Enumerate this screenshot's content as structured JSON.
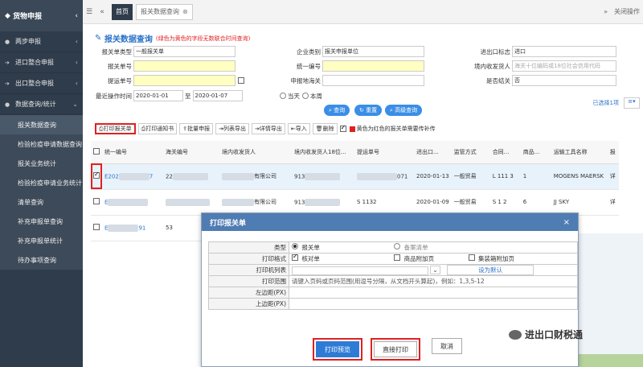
{
  "sidebar": {
    "title": "货物申报",
    "items": [
      {
        "label": "两步申报"
      },
      {
        "label": "进口整合申报"
      },
      {
        "label": "出口整合申报"
      },
      {
        "label": "数据查询/统计"
      }
    ],
    "subitems": [
      {
        "label": "报关数据查询"
      },
      {
        "label": "检验检疫申请数据查询"
      },
      {
        "label": "报关业务统计"
      },
      {
        "label": "检验检疫申请业务统计"
      },
      {
        "label": "清单查询"
      },
      {
        "label": "补充申报单查询"
      },
      {
        "label": "补充申报单统计"
      },
      {
        "label": "待办事项查询"
      }
    ]
  },
  "topbar": {
    "home_tab": "首页",
    "page_tab": "报关数据查询",
    "close_ops": "关闭操作"
  },
  "form": {
    "title": "报关数据查询",
    "note": "(绿色为黄色的字段无数联合时间查询)",
    "fields": {
      "decl_type_label": "报关单类型",
      "decl_type_value": "一般报关单",
      "company_type_label": "企业类别",
      "company_type_value": "报关申报单位",
      "ie_flag_label": "进出口标志",
      "ie_flag_value": "进口",
      "decl_no_label": "报关单号",
      "uni_no_label": "统一编号",
      "consignee_label": "境内收发货人",
      "consignee_placeholder": "海关十位编码或18位社会信用代码",
      "bill_no_label": "提运单号",
      "customs_label": "申报地海关",
      "is_closed_label": "是否结关",
      "is_closed_value": "否",
      "op_time_label": "最近操作时间",
      "date_from": "2020-01-01",
      "date_to_label": "至",
      "date_to": "2020-01-07",
      "today_label": "当天",
      "week_label": "本周"
    },
    "buttons": {
      "query": "查询",
      "reset": "重置",
      "advanced": "高级查询"
    }
  },
  "toolbar": {
    "print": "打印报关单",
    "print_notice": "打印通知书",
    "batch_declare": "批量申报",
    "export_list": "列表导出",
    "export_detail": "详情导出",
    "import": "导入",
    "delete": "删除",
    "red_note": "黄色为红色的报关单需要传补传",
    "selected": "已选择1项"
  },
  "grid": {
    "headers": [
      "统一编号",
      "海关编号",
      "境内收发货人",
      "境内收发货人18位...",
      "提运单号",
      "进出口...",
      "监管方式",
      "合同...",
      "商品...",
      "运输工具名称",
      "报"
    ],
    "rows": [
      {
        "uni": "E202",
        "uni_tail": "7",
        "cust": "22",
        "consignee": "有限公司",
        "c18": "913",
        "bill": "071",
        "date": "2020-01-13",
        "mode": "一般贸易",
        "contract": "L 111 3",
        "items": "1",
        "vessel": "MOGENS MAERSK",
        "op": "详"
      },
      {
        "uni": "E",
        "uni_tail": "",
        "cust": "",
        "consignee": "有限公司",
        "c18": "913",
        "bill": "S 1132",
        "date": "2020-01-09",
        "mode": "一般贸易",
        "contract": "S 1 2",
        "items": "6",
        "vessel": "JJ SKY",
        "op": "详"
      },
      {
        "uni": "E",
        "uni_tail": "91",
        "cust": "53",
        "consignee": "",
        "c18": "",
        "bill": "",
        "date": "",
        "mode": "",
        "contract": "",
        "items": "",
        "vessel": "",
        "op": ""
      }
    ]
  },
  "modal": {
    "title": "打印报关单",
    "close": "×",
    "type_label": "类型",
    "type_opt1": "报关单",
    "type_opt2": "备案清单",
    "format_label": "打印格式",
    "format_opt1": "核对单",
    "format_opt2": "商品附加页",
    "format_opt3": "集装箱附加页",
    "printer_label": "打印机列表",
    "set_default": "设为默认",
    "range_label": "打印范围",
    "range_hint": "请键入页码或页码范围(用逗号分隔，从文档开头算起)，例如：1,3,5-12",
    "left_margin_label": "左边距(PX)",
    "top_margin_label": "上边距(PX)",
    "preview_button": "打印预览",
    "direct_print_button": "直接打印",
    "cancel_button": "取消"
  },
  "watermark": {
    "text": "进出口财税通"
  }
}
